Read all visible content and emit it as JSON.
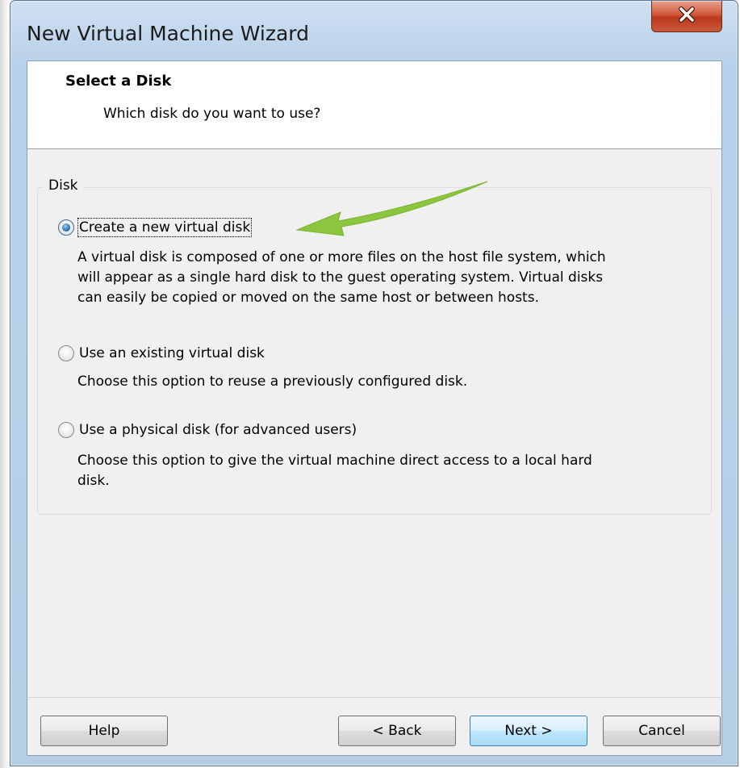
{
  "window": {
    "title": "New Virtual Machine Wizard"
  },
  "header": {
    "title": "Select a Disk",
    "subtitle": "Which disk do you want to use?"
  },
  "disk_group": {
    "legend": "Disk",
    "options": [
      {
        "label": "Create a new virtual disk",
        "selected": true,
        "description_lines": [
          "A virtual disk is composed of one or more files on the host file system, which",
          "will appear as a single hard disk to the guest operating system. Virtual disks",
          "can easily be copied or moved on the same host or between hosts."
        ]
      },
      {
        "label": "Use an existing virtual disk",
        "selected": false,
        "description_lines": [
          "Choose this option to reuse a previously configured disk."
        ]
      },
      {
        "label": "Use a physical disk (for advanced users)",
        "selected": false,
        "description_lines": [
          "Choose this option to give the virtual machine direct access to a local hard",
          "disk."
        ]
      }
    ]
  },
  "buttons": {
    "help": "Help",
    "back": "< Back",
    "next": "Next >",
    "cancel": "Cancel"
  },
  "colors": {
    "annotation_arrow": "#8cc63f",
    "close_button": "#c8432a"
  },
  "icons": {
    "close": "close-icon",
    "annotation": "arrow-annotation-icon"
  }
}
